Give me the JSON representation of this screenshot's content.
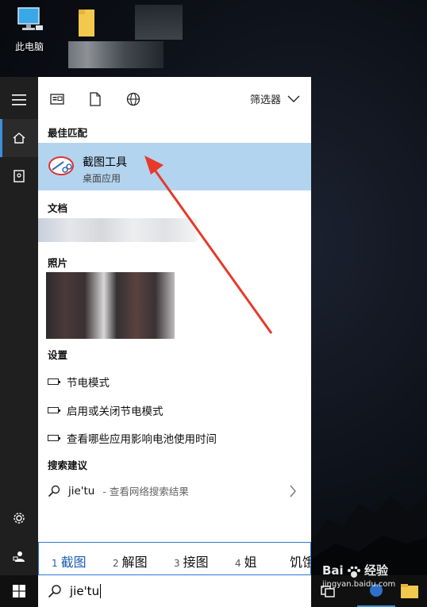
{
  "desktop": {
    "this_pc_label": "此电脑"
  },
  "toolbar": {
    "filter_label": "筛选器"
  },
  "sections": {
    "best_match": "最佳匹配",
    "documents": "文档",
    "photos": "照片",
    "settings": "设置",
    "search_suggestions": "搜索建议"
  },
  "best_match": {
    "title": "截图工具",
    "subtitle": "桌面应用"
  },
  "settings_items": [
    {
      "label": "节电模式"
    },
    {
      "label": "启用或关闭节电模式"
    },
    {
      "label": "查看哪些应用影响电池使用时间"
    }
  ],
  "suggestion": {
    "query": "jie'tu",
    "hint": "- 查看网络搜索结果"
  },
  "ime": {
    "candidates": [
      {
        "num": "1",
        "text": "截图"
      },
      {
        "num": "2",
        "text": "解图"
      },
      {
        "num": "3",
        "text": "接图"
      },
      {
        "num": "4",
        "text": "姐"
      },
      {
        "num": "",
        "text": "饥饿"
      }
    ]
  },
  "search": {
    "value": "jie'tu"
  },
  "watermark": {
    "brand": "Bai",
    "brand2": "经验",
    "url": "jingyan.baidu.com"
  },
  "colors": {
    "accent": "#3d8fd9",
    "selection": "#b3d4ee",
    "arrow": "#e8392b"
  }
}
